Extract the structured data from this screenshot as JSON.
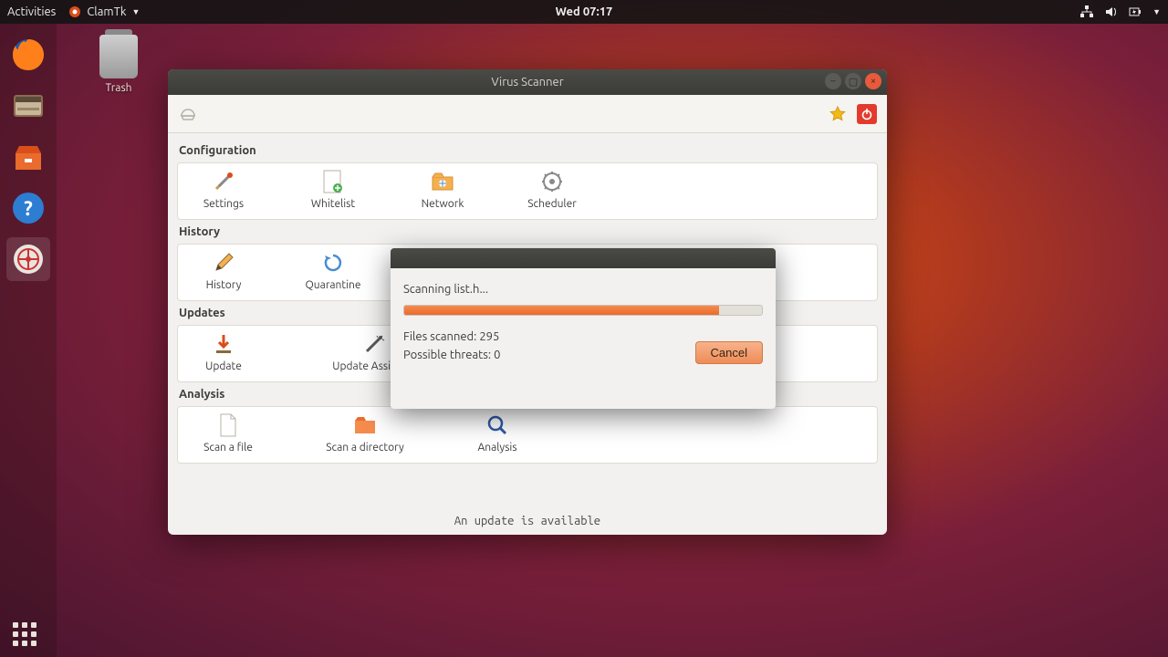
{
  "topbar": {
    "activities": "Activities",
    "app_name": "ClamTk",
    "clock": "Wed 07:17"
  },
  "desktop": {
    "trash_label": "Trash"
  },
  "window": {
    "title": "Virus Scanner",
    "sections": {
      "configuration": {
        "title": "Configuration",
        "items": [
          "Settings",
          "Whitelist",
          "Network",
          "Scheduler"
        ]
      },
      "history": {
        "title": "History",
        "items": [
          "History",
          "Quarantine"
        ]
      },
      "updates": {
        "title": "Updates",
        "items": [
          "Update",
          "Update Assistant"
        ]
      },
      "analysis": {
        "title": "Analysis",
        "items": [
          "Scan a file",
          "Scan a directory",
          "Analysis"
        ]
      }
    },
    "status": "An update is available"
  },
  "modal": {
    "scanning_label": "Scanning list.h...",
    "progress_percent": 88,
    "files_scanned_label": "Files scanned: 295",
    "threats_label": "Possible threats: 0",
    "cancel_label": "Cancel"
  }
}
